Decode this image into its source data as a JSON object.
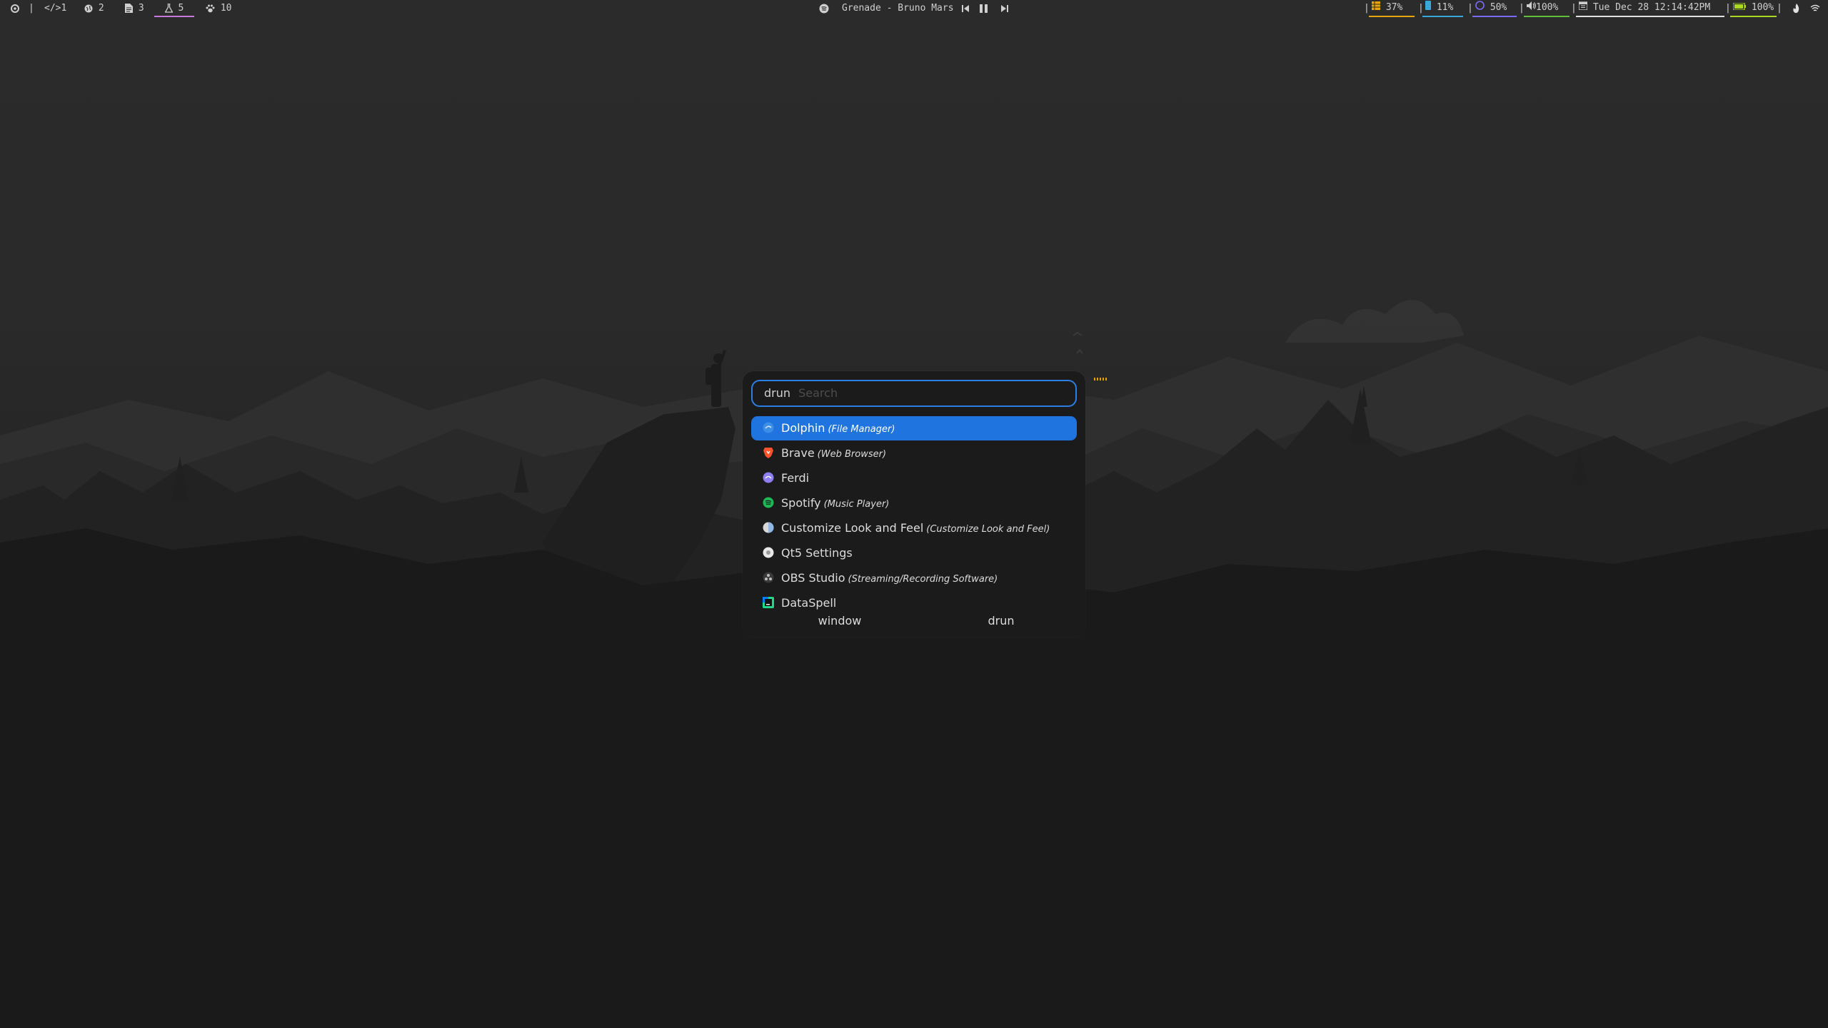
{
  "topbar": {
    "left": {
      "launcher_icon": "arch-gear-icon",
      "separator": "|",
      "workspaces": [
        {
          "label": "1",
          "icon": "code-icon",
          "active": false
        },
        {
          "label": "2",
          "icon": "globe-icon",
          "active": false
        },
        {
          "label": "3",
          "icon": "file-icon",
          "active": false
        },
        {
          "label": "5",
          "icon": "flask-icon",
          "active": true
        },
        {
          "label": "10",
          "icon": "paw-icon",
          "active": false
        }
      ]
    },
    "media": {
      "icon": "spotify-icon",
      "track": "Grenade - Bruno Mars",
      "prev_icon": "skip-back-icon",
      "pause_icon": "pause-icon",
      "next_icon": "skip-forward-icon"
    },
    "right": {
      "modules": [
        {
          "name": "cpu",
          "icon": "cpu-icon",
          "value": "37%",
          "color": "#e5a50a"
        },
        {
          "name": "memory",
          "icon": "memory-icon",
          "value": "11%",
          "color": "#3aa7d9"
        },
        {
          "name": "disk",
          "icon": "disk-icon",
          "value": "50%",
          "color": "#7b6cf6"
        },
        {
          "name": "volume",
          "icon": "volume-icon",
          "value": "100%",
          "color": "#5fbf3a"
        },
        {
          "name": "clock",
          "icon": "calendar-icon",
          "value": "Tue Dec 28 12:14:42PM",
          "color": "#e0e0e0"
        },
        {
          "name": "battery",
          "icon": "battery-icon",
          "value": "100%",
          "color": "#a8d920"
        }
      ],
      "separator": "|",
      "tray": [
        "flame-icon",
        "wifi-icon"
      ]
    }
  },
  "launcher": {
    "prompt": "drun",
    "placeholder": "Search",
    "entries": [
      {
        "name": "Dolphin",
        "desc": "(File Manager)",
        "icon": "dolphin-icon",
        "icon_color": "#3d8ee6",
        "selected": true
      },
      {
        "name": "Brave",
        "desc": "(Web Browser)",
        "icon": "brave-icon",
        "icon_color": "#fb542b",
        "selected": false
      },
      {
        "name": "Ferdi",
        "desc": "",
        "icon": "ferdi-icon",
        "icon_color": "#8e7ff0",
        "selected": false
      },
      {
        "name": "Spotify",
        "desc": "(Music Player)",
        "icon": "spotify-icon",
        "icon_color": "#1db954",
        "selected": false
      },
      {
        "name": "Customize Look and Feel",
        "desc": "(Customize Look and Feel)",
        "icon": "appearance-icon",
        "icon_color": "#d8d8d8",
        "selected": false
      },
      {
        "name": "Qt5 Settings",
        "desc": "",
        "icon": "qt5-settings-icon",
        "icon_color": "#e8e8e8",
        "selected": false
      },
      {
        "name": "OBS Studio",
        "desc": "(Streaming/Recording Software)",
        "icon": "obs-icon",
        "icon_color": "#3a3a3a",
        "selected": false
      },
      {
        "name": "DataSpell",
        "desc": "",
        "icon": "dataspell-icon",
        "icon_color": "#21d789",
        "selected": false
      }
    ],
    "modes": [
      "window",
      "drun"
    ]
  }
}
